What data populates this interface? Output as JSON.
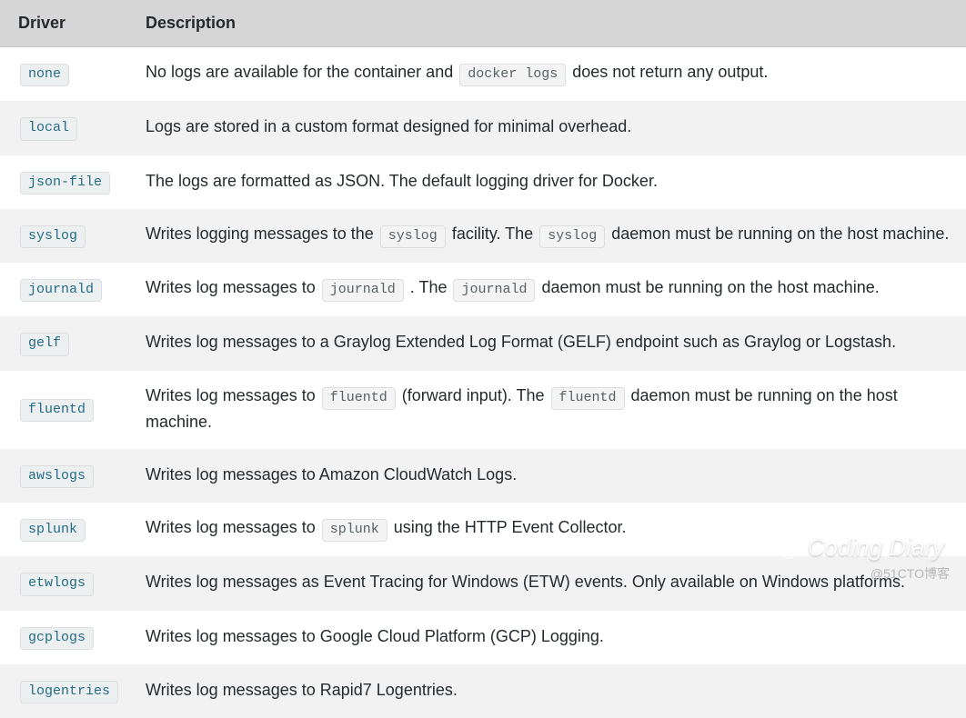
{
  "table": {
    "header": {
      "driver": "Driver",
      "description": "Description"
    },
    "rows": [
      {
        "driver": "none",
        "desc": [
          "No logs are available for the container and ",
          {
            "code": "docker logs"
          },
          " does not return any output."
        ]
      },
      {
        "driver": "local",
        "desc": [
          "Logs are stored in a custom format designed for minimal overhead."
        ]
      },
      {
        "driver": "json-file",
        "desc": [
          "The logs are formatted as JSON. The default logging driver for Docker."
        ]
      },
      {
        "driver": "syslog",
        "desc": [
          "Writes logging messages to the ",
          {
            "code": "syslog"
          },
          " facility. The ",
          {
            "code": "syslog"
          },
          " daemon must be running on the host machine."
        ]
      },
      {
        "driver": "journald",
        "desc": [
          "Writes log messages to ",
          {
            "code": "journald"
          },
          " . The ",
          {
            "code": "journald"
          },
          " daemon must be running on the host machine."
        ]
      },
      {
        "driver": "gelf",
        "desc": [
          "Writes log messages to a Graylog Extended Log Format (GELF) endpoint such as Graylog or Logstash."
        ]
      },
      {
        "driver": "fluentd",
        "desc": [
          "Writes log messages to ",
          {
            "code": "fluentd"
          },
          " (forward input). The ",
          {
            "code": "fluentd"
          },
          " daemon must be running on the host machine."
        ]
      },
      {
        "driver": "awslogs",
        "desc": [
          "Writes log messages to Amazon CloudWatch Logs."
        ]
      },
      {
        "driver": "splunk",
        "desc": [
          "Writes log messages to ",
          {
            "code": "splunk"
          },
          " using the HTTP Event Collector."
        ]
      },
      {
        "driver": "etwlogs",
        "desc": [
          "Writes log messages as Event Tracing for Windows (ETW) events. Only available on Windows platforms."
        ]
      },
      {
        "driver": "gcplogs",
        "desc": [
          "Writes log messages to Google Cloud Platform (GCP) Logging."
        ]
      },
      {
        "driver": "logentries",
        "desc": [
          "Writes log messages to Rapid7 Logentries."
        ]
      }
    ]
  },
  "watermark": {
    "text": "Coding Diary"
  },
  "credit": "@51CTO博客"
}
